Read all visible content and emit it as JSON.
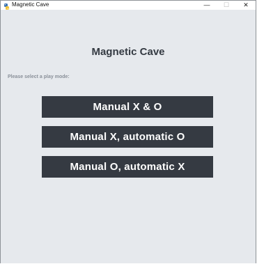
{
  "window": {
    "title": "Magnetic Cave",
    "minimize_glyph": "—",
    "maximize_glyph": "☐",
    "close_glyph": "✕"
  },
  "main": {
    "heading": "Magnetic Cave",
    "prompt": "Please select a play mode:",
    "modes": [
      {
        "label": "Manual X & O"
      },
      {
        "label": "Manual X, automatic O"
      },
      {
        "label": "Manual O, automatic X"
      }
    ]
  },
  "colors": {
    "background": "#e6e9ed",
    "button": "#353a42",
    "button_text": "#ffffff",
    "heading": "#343a42",
    "prompt": "#8a9099"
  },
  "icons": {
    "app": "snake-app-icon",
    "minimize": "minimize-icon",
    "maximize": "maximize-icon",
    "close": "close-icon"
  }
}
